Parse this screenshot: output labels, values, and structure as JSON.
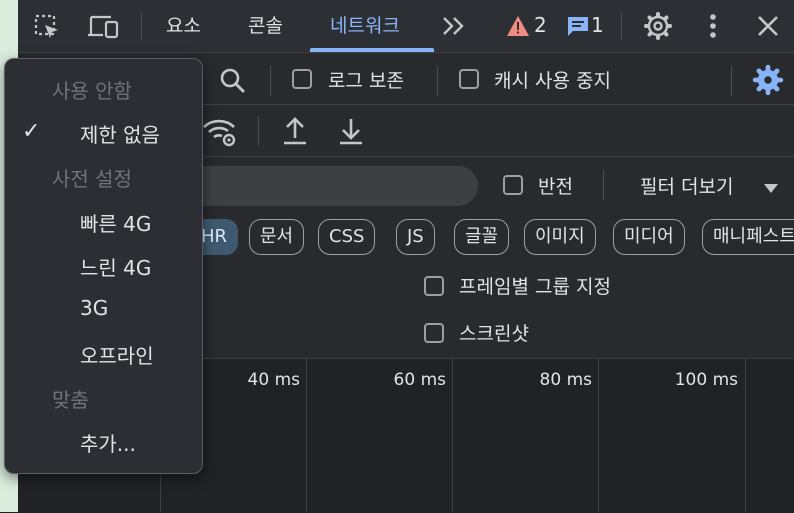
{
  "tabs": [
    {
      "label": "요소"
    },
    {
      "label": "콘솔"
    },
    {
      "label": "네트워크"
    }
  ],
  "status": {
    "warnings": "2",
    "messages": "1"
  },
  "toolbar": {
    "preserve_log": "로그 보존",
    "disable_cache": "캐시 사용 중지",
    "invert": "반전",
    "more_filters": "필터 더보기"
  },
  "chips": [
    "HR",
    "문서",
    "CSS",
    "JS",
    "글꼴",
    "이미지",
    "미디어",
    "매니페스트"
  ],
  "options": {
    "group_by_frame": "프레임별 그룹 지정",
    "screenshots": "스크린샷"
  },
  "timeline_ticks": [
    "40 ms",
    "60 ms",
    "80 ms",
    "100 ms"
  ],
  "throttle_menu": {
    "disabled_header": "사용 안함",
    "no_throttling": "제한 없음",
    "presets_header": "사전 설정",
    "fast4g": "빠른 4G",
    "slow4g": "느린 4G",
    "g3": "3G",
    "offline": "오프라인",
    "custom_header": "맞춤",
    "add": "추가...",
    "selected_mark": "✓"
  },
  "colors": {
    "accent": "#8ab4f8",
    "warning": "#f28b82"
  }
}
